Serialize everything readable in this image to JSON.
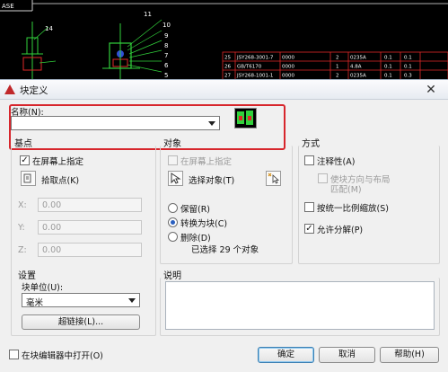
{
  "cad": {
    "corner_label": "ASE",
    "callouts": [
      "14",
      "11",
      "10",
      "9",
      "8",
      "7",
      "6",
      "5"
    ],
    "table_rows": [
      [
        "25",
        "JSY268-3001-7",
        "0000",
        "2",
        "0235A",
        "0.1",
        "0.1"
      ],
      [
        "26",
        "GB/T6170",
        "0000",
        "1",
        "4.8A",
        "0.1",
        "0.1"
      ],
      [
        "27",
        "JSY268-1001-1",
        "0000",
        "2",
        "0235A",
        "0.1",
        "0.3"
      ]
    ]
  },
  "dialog": {
    "title": "块定义",
    "close": "✕",
    "name_label": "名称(N):",
    "name_value": "",
    "base_point": {
      "title": "基点",
      "specify_on_screen": "在屏幕上指定",
      "pick_point": "拾取点(K)",
      "x_label": "X:",
      "y_label": "Y:",
      "z_label": "Z:",
      "x": "0.00",
      "y": "0.00",
      "z": "0.00"
    },
    "objects": {
      "title": "对象",
      "specify_on_screen": "在屏幕上指定",
      "select_objects": "选择对象(T)",
      "retain": "保留(R)",
      "convert": "转换为块(C)",
      "delete": "删除(D)",
      "selected_info": "已选择 29 个对象"
    },
    "behavior": {
      "title": "方式",
      "annotative": "注释性(A)",
      "match_orientation_1": "使块方向与布局",
      "match_orientation_2": "匹配(M)",
      "scale_uniformly": "按统一比例缩放(S)",
      "allow_exploding": "允许分解(P)"
    },
    "settings": {
      "title": "设置",
      "units_label": "块单位(U):",
      "units_value": "毫米",
      "hyperlink": "超链接(L)..."
    },
    "description": {
      "title": "说明",
      "value": ""
    },
    "open_in_editor": "在块编辑器中打开(O)",
    "ok": "确定",
    "cancel": "取消",
    "help": "帮助(H)"
  },
  "colors": {
    "highlight": "#d7262c",
    "cad_green": "#32d23c",
    "cad_red": "#e02828",
    "title_icon": "#c0282a"
  }
}
